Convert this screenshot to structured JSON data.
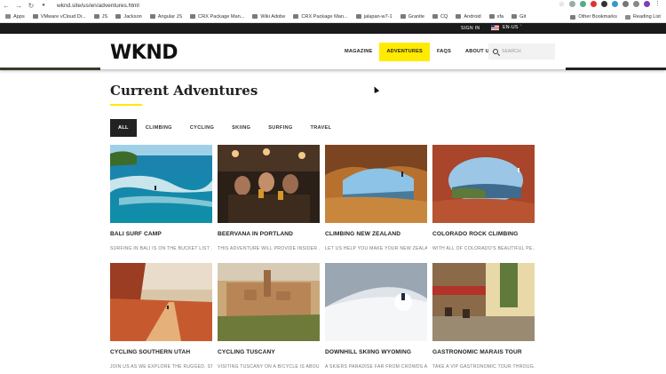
{
  "browser": {
    "url": "wknd.site/us/en/adventures.html",
    "bookmarks": [
      "Apps",
      "VMware vCloud Di...",
      "JS",
      "Jackson",
      "Angular JS",
      "CRX Package Man...",
      "Wiki Adobe",
      "CRX Package Man...",
      "jalapan-w7-1",
      "Granite",
      "CQ",
      "Android",
      "xfa",
      "Git"
    ],
    "other_bookmarks": "Other Bookmarks",
    "reading_list": "Reading List"
  },
  "topbar": {
    "signin": "SIGN IN",
    "language": "EN-US"
  },
  "header": {
    "logo": "WKND",
    "nav": [
      {
        "label": "MAGAZINE",
        "active": false
      },
      {
        "label": "ADVENTURES",
        "active": true
      },
      {
        "label": "FAQS",
        "active": false
      },
      {
        "label": "ABOUT US",
        "active": false
      }
    ],
    "search_placeholder": "SEARCH"
  },
  "main": {
    "title": "Current Adventures",
    "filters": [
      {
        "label": "ALL",
        "active": true
      },
      {
        "label": "CLIMBING",
        "active": false
      },
      {
        "label": "CYCLING",
        "active": false
      },
      {
        "label": "SKIING",
        "active": false
      },
      {
        "label": "SURFING",
        "active": false
      },
      {
        "label": "TRAVEL",
        "active": false
      }
    ],
    "cards": [
      {
        "title": "BALI SURF CAMP",
        "desc": "SURFING IN BALI IS ON THE BUCKET LIST ...",
        "image": "surf-ocean-photo"
      },
      {
        "title": "BEERVANA IN PORTLAND",
        "desc": "THIS ADVENTURE WILL PROVIDE INSIDER ...",
        "image": "brewery-friends-photo"
      },
      {
        "title": "CLIMBING NEW ZEALAND",
        "desc": "LET US HELP YOU MAKE YOUR NEW ZEALA...",
        "image": "cave-climber-photo"
      },
      {
        "title": "COLORADO ROCK CLIMBING",
        "desc": "WITH ALL OF COLORADO'S BEAUTIFUL PE...",
        "image": "red-rock-arch-photo"
      },
      {
        "title": "CYCLING SOUTHERN UTAH",
        "desc": "JOIN US AS WE EXPLORE THE RUGGED, ST...",
        "image": "desert-road-photo"
      },
      {
        "title": "CYCLING TUSCANY",
        "desc": "VISITING TUSCANY ON A BICYCLE IS ABOU...",
        "image": "tuscan-town-photo"
      },
      {
        "title": "DOWNHILL SKIING WYOMING",
        "desc": "A SKIERS PARADISE FAR FROM CROWDS A...",
        "image": "skier-powder-photo"
      },
      {
        "title": "GASTRONOMIC MARAIS TOUR",
        "desc": "TAKE A VIP GASTRONOMIC TOUR THROUG...",
        "image": "paris-cafe-photo"
      }
    ]
  }
}
